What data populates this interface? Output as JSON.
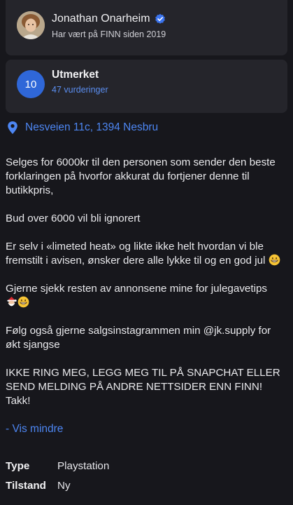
{
  "seller": {
    "name": "Jonathan Onarheim",
    "since": "Har vært på FINN siden 2019",
    "verified_icon": "verified-check-icon"
  },
  "rating": {
    "score": "10",
    "title": "Utmerket",
    "count": "47 vurderinger"
  },
  "location": {
    "icon": "location-pin-icon",
    "address": "Nesveien 11c, 1394 Nesbru"
  },
  "description": {
    "p1": "Selges for 6000kr til den personen som sender den beste forklaringen på hvorfor akkurat du fortjener denne til butikkpris,",
    "p2": "Bud over 6000 vil bli ignorert",
    "p3": "Er selv i «limeted heat» og likte ikke helt hvordan vi ble fremstilt i avisen, ønsker dere alle lykke til og en god jul",
    "p4": "Gjerne sjekk resten av annonsene mine for julegavetips",
    "p5": "Følg også gjerne salgsinstagrammen min @jk.supply for økt sjangse",
    "p6": "IKKE RING MEG, LEGG MEG TIL PÅ SNAPCHAT ELLER SEND MELDING PÅ ANDRE NETTSIDER ENN FINN! Takk!"
  },
  "toggle": {
    "label": "- Vis mindre"
  },
  "specs": [
    {
      "key": "Type",
      "value": "Playstation"
    },
    {
      "key": "Tilstand",
      "value": "Ny"
    }
  ],
  "colors": {
    "background": "#17171c",
    "card": "#25252b",
    "accent": "#2f67d8",
    "link": "#4d86f2"
  }
}
